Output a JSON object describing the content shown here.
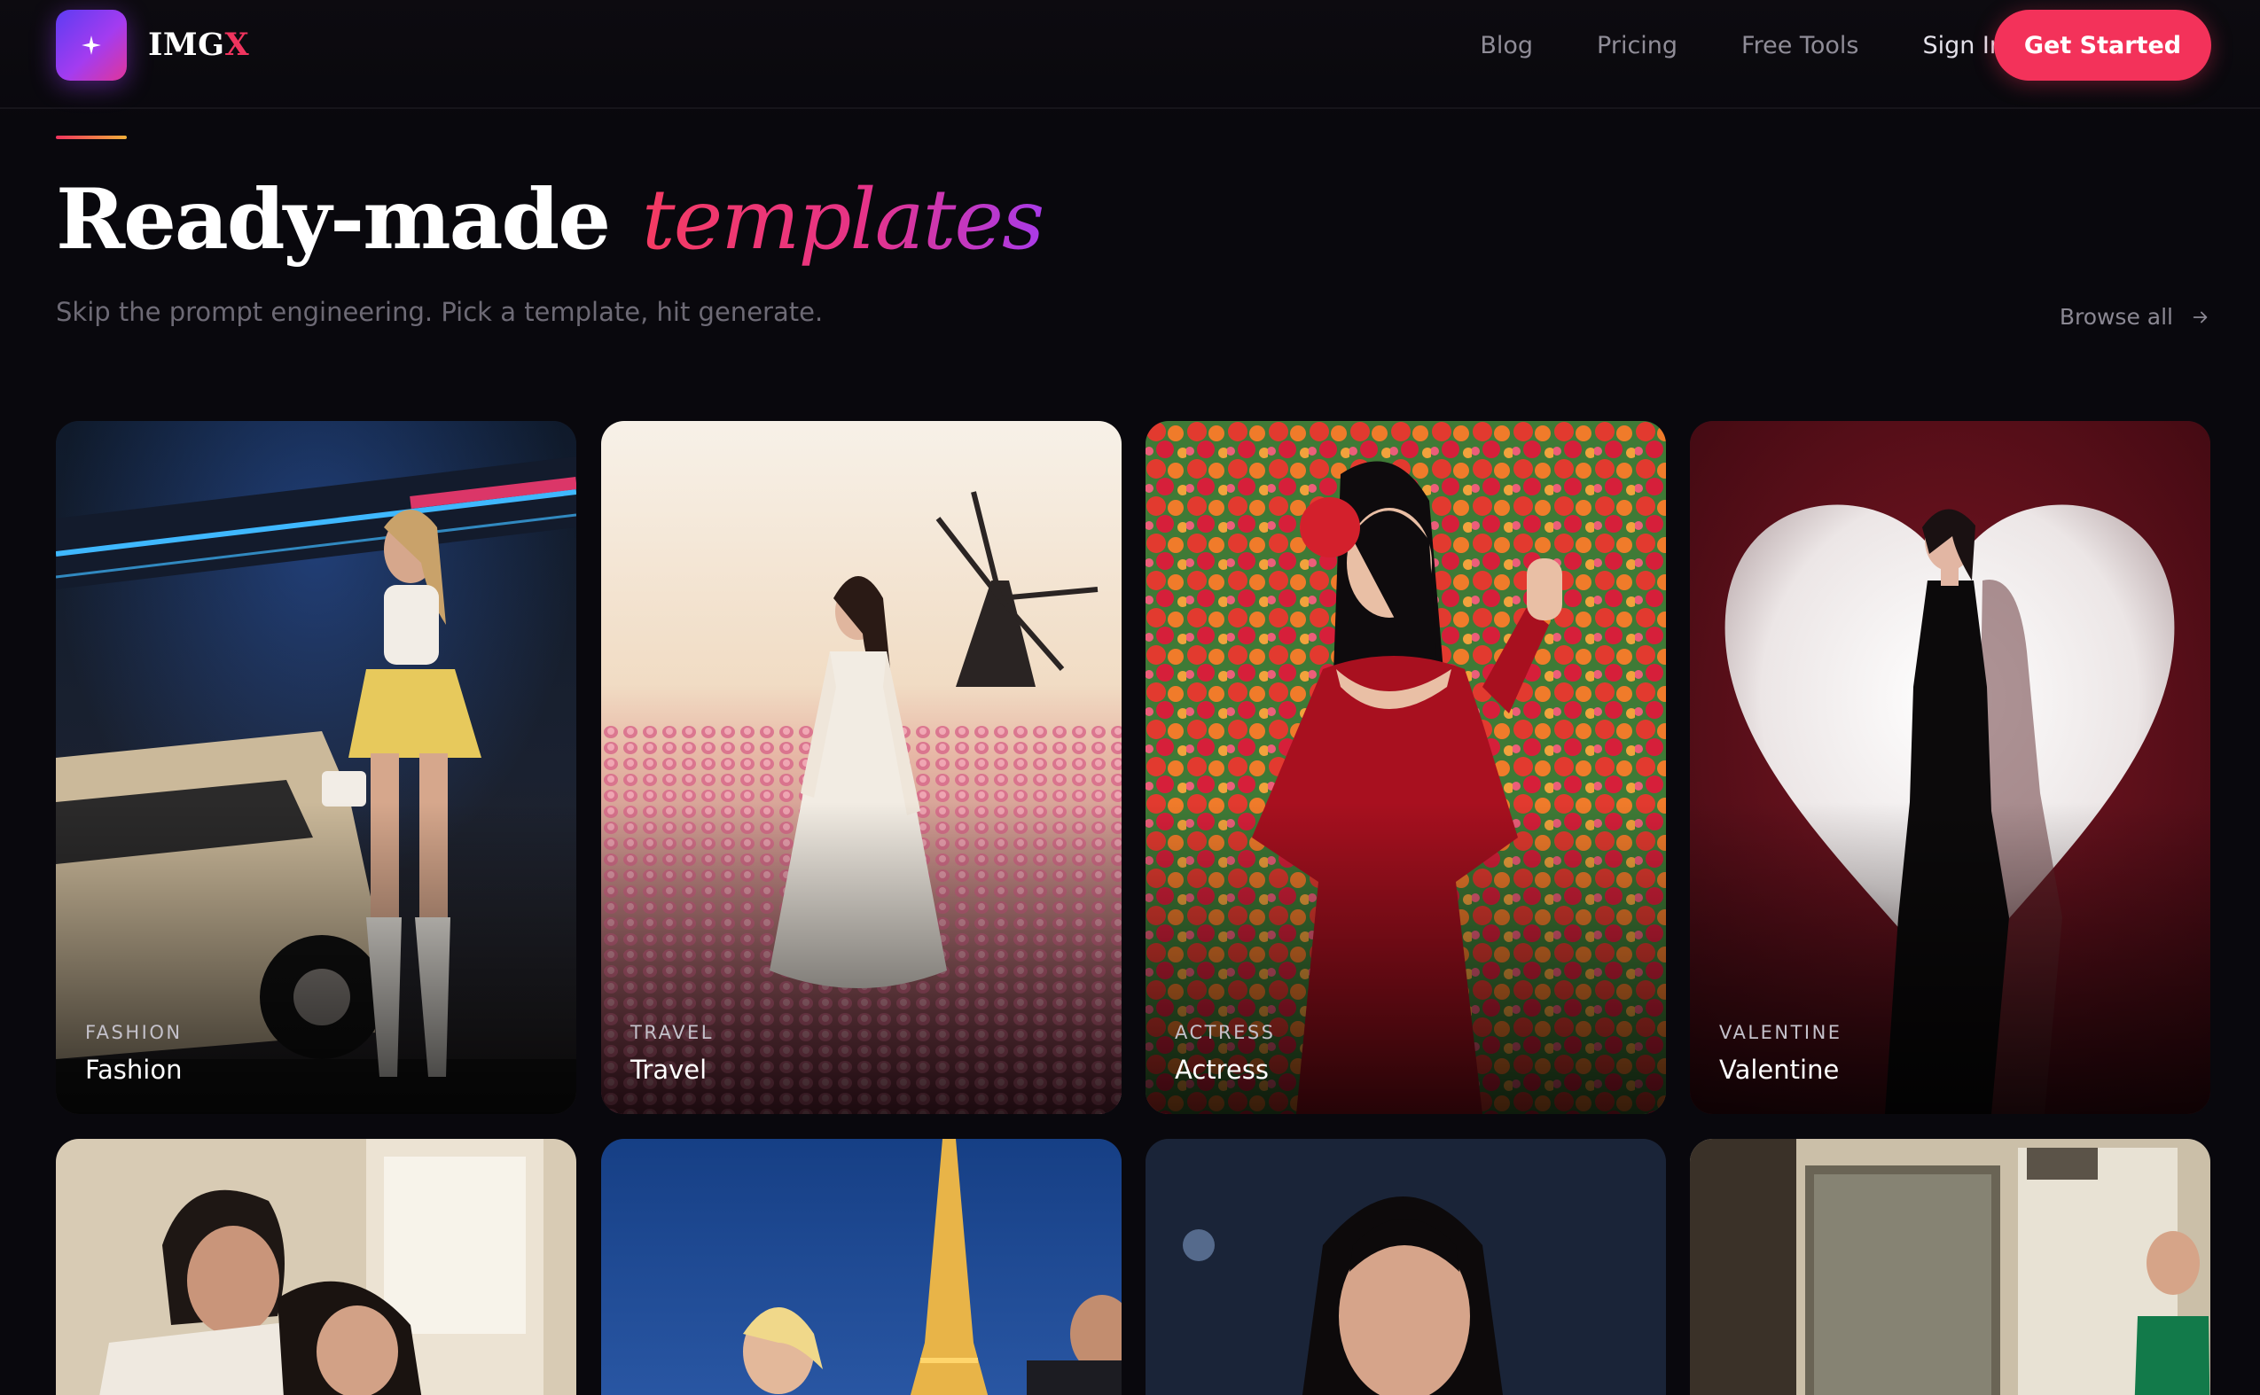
{
  "nav": {
    "brand_prefix": "IMG",
    "brand_suffix": "X",
    "links": [
      "Blog",
      "Pricing",
      "Free Tools",
      "Sign In"
    ],
    "cta_label": "Get Started"
  },
  "header": {
    "title_main": "Ready-made",
    "title_accent": "templates",
    "subtitle": "Skip the prompt engineering. Pick a template, hit generate.",
    "browse_label": "Browse all"
  },
  "templates": [
    {
      "category": "FASHION",
      "name": "Fashion"
    },
    {
      "category": "TRAVEL",
      "name": "Travel"
    },
    {
      "category": "ACTRESS",
      "name": "Actress"
    },
    {
      "category": "VALENTINE",
      "name": "Valentine"
    }
  ],
  "colors": {
    "accent": "#f3325a",
    "background": "#09080d",
    "logo_gradient_start": "#5d3cf2",
    "logo_gradient_end": "#e0359a"
  },
  "icons": {
    "logo": "sparkle-icon",
    "browse": "arrow-right-icon"
  }
}
